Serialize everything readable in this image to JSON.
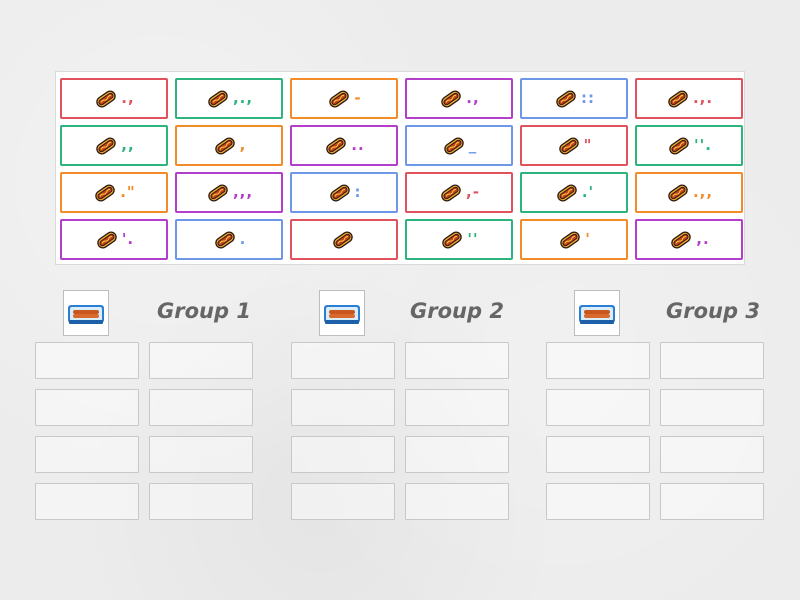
{
  "colors": {
    "red": "#e0535d",
    "green": "#2db37c",
    "orange": "#f28c28",
    "purple": "#b23ec9",
    "blue": "#6f97e8",
    "title_gray": "#666666",
    "background": "#ececec"
  },
  "cards": [
    {
      "symbol": ".,",
      "color": "red"
    },
    {
      "symbol": ",.,",
      "color": "green"
    },
    {
      "symbol": "-",
      "color": "orange"
    },
    {
      "symbol": ".,",
      "color": "purple"
    },
    {
      "symbol": "::",
      "color": "blue"
    },
    {
      "symbol": ".,.",
      "color": "red"
    },
    {
      "symbol": ",,",
      "color": "green"
    },
    {
      "symbol": ",",
      "color": "orange"
    },
    {
      "symbol": "..",
      "color": "purple"
    },
    {
      "symbol": "_",
      "color": "blue"
    },
    {
      "symbol": "\"",
      "color": "red"
    },
    {
      "symbol": "''.",
      "color": "green"
    },
    {
      "symbol": ".\"",
      "color": "orange"
    },
    {
      "symbol": ",,,",
      "color": "purple"
    },
    {
      "symbol": ":",
      "color": "blue"
    },
    {
      "symbol": ",-",
      "color": "red"
    },
    {
      "symbol": ".'",
      "color": "green"
    },
    {
      "symbol": ".,,",
      "color": "orange"
    },
    {
      "symbol": "'.",
      "color": "purple"
    },
    {
      "symbol": ".",
      "color": "blue"
    },
    {
      "symbol": "",
      "color": "red"
    },
    {
      "symbol": "''",
      "color": "green"
    },
    {
      "symbol": "'",
      "color": "orange"
    },
    {
      "symbol": ",.",
      "color": "purple"
    }
  ],
  "groups": [
    {
      "title": "Group 1",
      "icon": "hotdog-pack-icon"
    },
    {
      "title": "Group 2",
      "icon": "hotdog-pack-icon"
    },
    {
      "title": "Group 3",
      "icon": "hotdog-pack-icon"
    }
  ]
}
